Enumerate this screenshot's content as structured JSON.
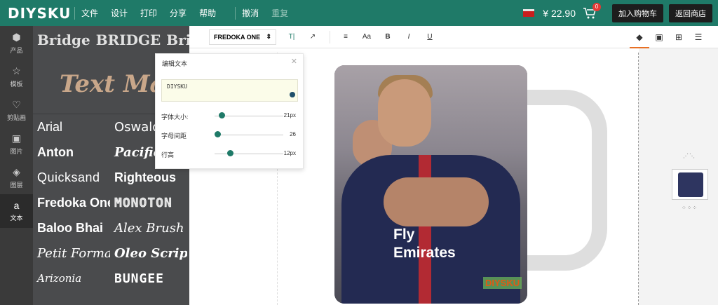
{
  "topbar": {
    "logo": "DIYSKU",
    "menu": [
      "文件",
      "设计",
      "打印",
      "分享",
      "帮助"
    ],
    "undo": "撤消",
    "redo": "重复",
    "price": "¥ 22.90",
    "cart_badge": "0",
    "add_to_cart": "加入购物车",
    "back_to_shop": "返回商店"
  },
  "nav": [
    {
      "label": "产品",
      "icon": "cube-icon",
      "glyph": "⬢"
    },
    {
      "label": "模板",
      "icon": "star-icon",
      "glyph": "☆"
    },
    {
      "label": "剪贴画",
      "icon": "heart-icon",
      "glyph": "♡"
    },
    {
      "label": "图片",
      "icon": "image-icon",
      "glyph": "▣"
    },
    {
      "label": "图层",
      "icon": "layers-icon",
      "glyph": "◈"
    },
    {
      "label": "文本",
      "icon": "text-icon",
      "glyph": "a"
    }
  ],
  "fonts": {
    "bridge_row": [
      "Bridge",
      "BRIDGE",
      "Bridge"
    ],
    "text_mask": "Text Mask",
    "grid": [
      "Arial",
      "Oswald",
      "Anton",
      "Pacifico",
      "Quicksand",
      "Righteous",
      "Fredoka One",
      "MONOTON",
      "Baloo Bhai",
      "Alex Brush",
      "Petit Formal",
      "Oleo Script S",
      "Arizonia",
      "BUNGEE"
    ]
  },
  "toolbar": {
    "font_name": "FREDOKA ONE",
    "tools": [
      "T|",
      "↗",
      "≡",
      "Aa",
      "B",
      "I",
      "U"
    ],
    "right_tools": [
      "fill-icon",
      "layer-order-icon",
      "grid-icon",
      "adjust-icon"
    ]
  },
  "popup": {
    "title": "编辑文本",
    "text_value": "DIYSKU",
    "font_size_label": "字体大小:",
    "font_size_value": "21px",
    "font_size_level": 0.06,
    "letter_spacing_label": "字母间距",
    "letter_spacing_value": "26",
    "letter_spacing_level": 0.0,
    "line_height_label": "行高",
    "line_height_value": "12px",
    "line_height_level": 0.18
  },
  "product": {
    "sponsor_line1": "Fly",
    "sponsor_line2": "Emirates",
    "mug_brand": "DIYSKU"
  },
  "colors": {
    "brand": "#1f7a68",
    "panel": "#4a4b4d",
    "accent": "#e87025"
  }
}
